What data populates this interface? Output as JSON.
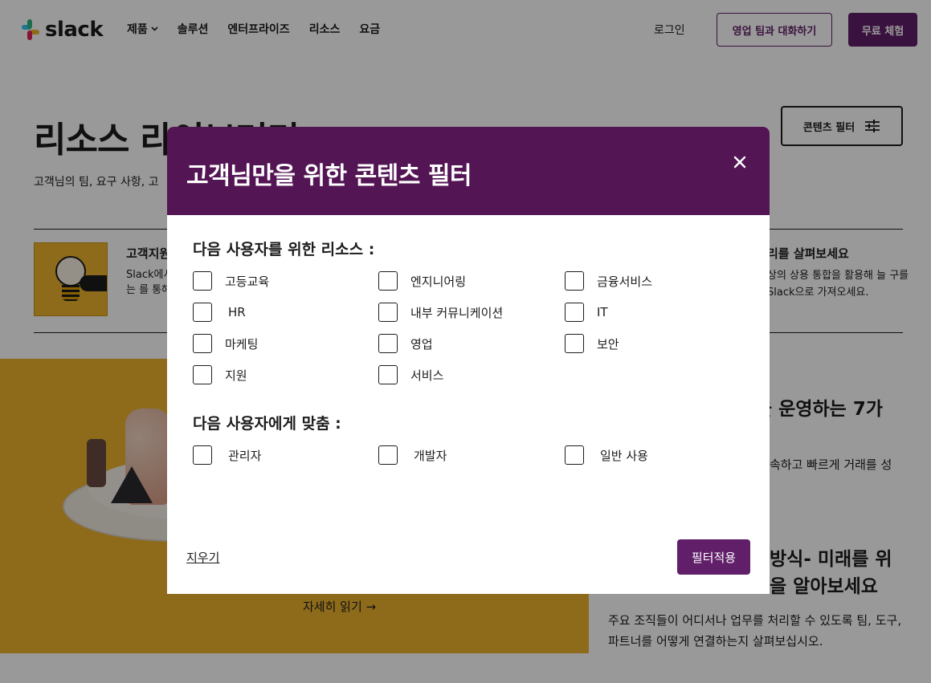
{
  "nav": {
    "logo_text": "slack",
    "links": [
      "제품",
      "솔루션",
      "엔터프라이즈",
      "리소스",
      "요금"
    ],
    "login": "로그인",
    "sales_button": "영업 팀과 대화하기",
    "trial_button": "무료 체험"
  },
  "hero": {
    "title": "리소스 라이브러리",
    "subtitle": "고객님의 팀, 요구 사항, 고",
    "filter_button": "콘텐츠 필터"
  },
  "cards": [
    {
      "title": "고객지원",
      "body": "Slack에서 수행하는 를 통해 업"
    },
    {
      "title": "리를 살펴보세요",
      "body": "상의 상용 통합을 활용해 늘 구를 Slack으로 가져오세요."
    }
  ],
  "features": {
    "readmore": "자세히 읽기 →",
    "f2_title": "을 운영하는 7가",
    "f2_body": "속하고 빠르게 거래를 성",
    "f3_title_lines": [
      "방식- 미래를 위",
      "을 알아보세요"
    ],
    "f3_body": "주요 조직들이 어디서나 업무를 처리할 수 있도록 팀, 도구, 파트너를 어떻게 연결하는지 살펴보십시오."
  },
  "modal": {
    "title": "고객님만을 위한 콘텐츠 필터",
    "section1_title": "다음 사용자를 위한 리소스 :",
    "resources": [
      "고등교육",
      "엔지니어링",
      "금융서비스",
      "HR",
      "내부 커뮤니케이션",
      "IT",
      "마케팅",
      "영업",
      "보안",
      "지원",
      "서비스"
    ],
    "section2_title": "다음 사용자에게 맞춤 :",
    "audiences": [
      "관리자",
      "개발자",
      "일반 사용"
    ],
    "clear_label": "지우기",
    "apply_label": "필터적용"
  },
  "colors": {
    "aubergine": "#611f69",
    "modal_header": "#541554",
    "feature_yellow": "#ecb22e"
  }
}
